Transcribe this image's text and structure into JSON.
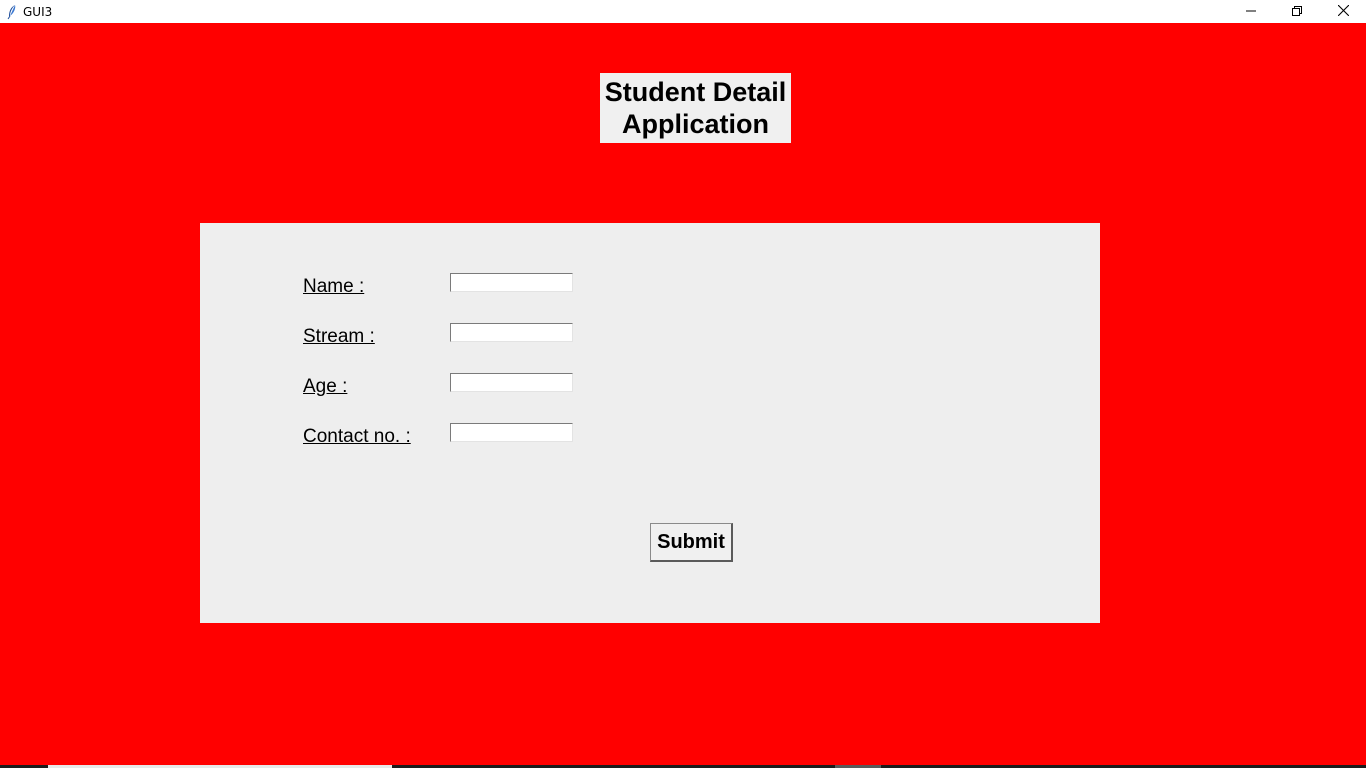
{
  "window": {
    "title": "GUI3",
    "background_color": "#ff0000"
  },
  "titlebar": {
    "app_icon": "feather-icon",
    "controls": [
      "minimize-icon",
      "restore-icon",
      "close-icon"
    ]
  },
  "heading": {
    "line1": "Student Detail",
    "line2": "Application"
  },
  "form": {
    "fields": [
      {
        "label": "Name :",
        "value": ""
      },
      {
        "label": "Stream :",
        "value": ""
      },
      {
        "label": "Age :",
        "value": ""
      },
      {
        "label": "Contact no. :",
        "value": ""
      }
    ],
    "submit_label": "Submit"
  }
}
